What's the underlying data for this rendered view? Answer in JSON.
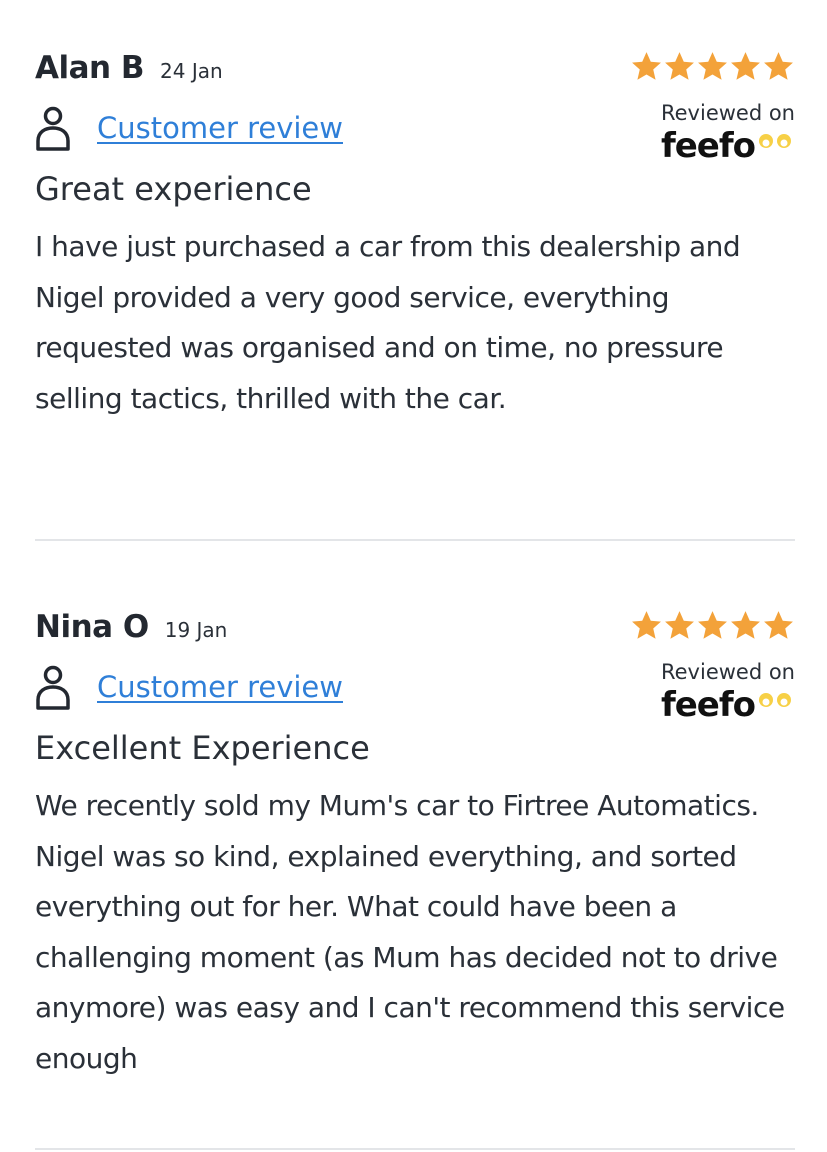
{
  "colors": {
    "link": "#2f7fd8",
    "star": "#f3a23a",
    "text": "#2a3038",
    "divider": "#e3e5e8"
  },
  "badge": {
    "reviewed_on": "Reviewed on",
    "brand": "feefo"
  },
  "reviews": [
    {
      "name": "Alan B",
      "date": "24 Jan",
      "type": "Customer review",
      "rating": 5,
      "title": "Great experience",
      "body": "I have just purchased a car from this dealership and Nigel provided a very good service, everything requested was organised and on time, no pressure selling tactics, thrilled with the car."
    },
    {
      "name": "Nina O",
      "date": "19 Jan",
      "type": "Customer review",
      "rating": 5,
      "title": "Excellent Experience",
      "body": "We recently sold my Mum's car to Firtree Automatics. Nigel was so kind, explained everything, and sorted everything out for her. What could have been a challenging moment (as Mum has decided not to drive anymore) was easy and I can't recommend this service enough"
    }
  ]
}
